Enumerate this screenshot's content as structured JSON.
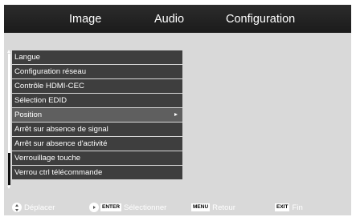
{
  "tabs": [
    {
      "label": "Image"
    },
    {
      "label": "Audio"
    },
    {
      "label": "Configuration"
    }
  ],
  "active_tab": "Configuration",
  "menu": {
    "items": [
      {
        "label": "Langue"
      },
      {
        "label": "Configuration réseau"
      },
      {
        "label": "Contrôle HDMI-CEC"
      },
      {
        "label": "Sélection EDID"
      },
      {
        "label": "Position",
        "submenu_arrow": "right-arrow-icon"
      },
      {
        "label": "Arrêt sur absence de signal"
      },
      {
        "label": "Arrêt sur absence d'activité"
      },
      {
        "label": "Verrouillage touche"
      },
      {
        "label": "Verrou ctrl télécommande"
      }
    ],
    "selected_index": 4
  },
  "help": {
    "move_label": "Déplacer",
    "enter_key": "ENTER",
    "select_label": "Sélectionner",
    "menu_key": "MENU",
    "back_label": "Retour",
    "exit_key": "EXIT",
    "end_label": "Fin"
  },
  "colors": {
    "tab_bar": "#222222",
    "panel_background": "#d9d9d9",
    "menu_item": "#3e3e3e",
    "menu_item_selected": "#5f5f5f",
    "text": "#ffffff"
  }
}
